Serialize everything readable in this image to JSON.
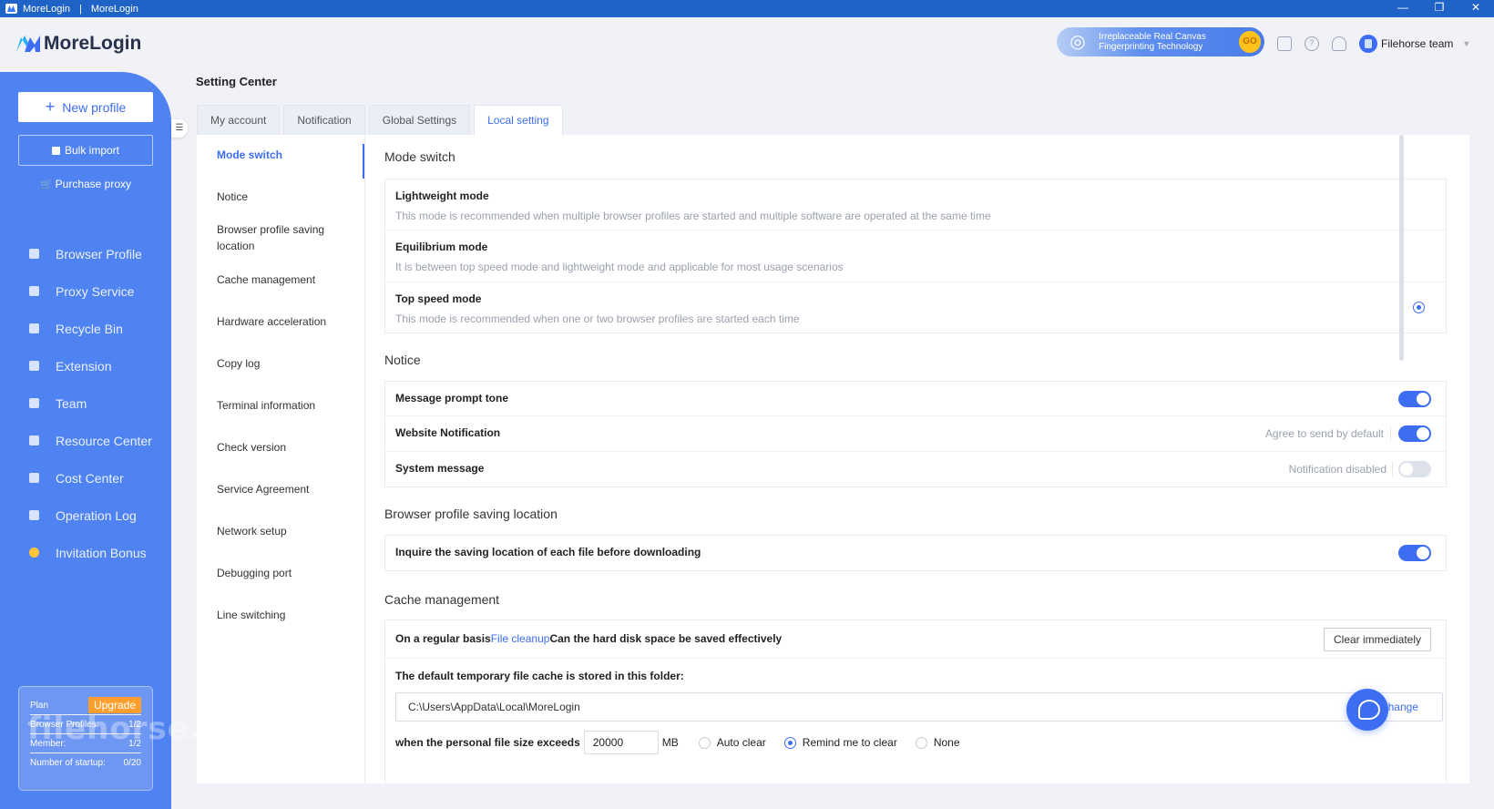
{
  "titlebar": {
    "app": "MoreLogin",
    "separator": "|",
    "window_title": "MoreLogin",
    "minimize": "—",
    "restore": "❐",
    "close": "✕"
  },
  "header": {
    "logo": "MoreLogin",
    "promo": {
      "line1": "Irreplaceable Real Canvas",
      "line2": "Fingerprinting Technology",
      "go": "GO"
    },
    "team": "Filehorse team"
  },
  "sidebar": {
    "new_profile": "New profile",
    "bulk_import": "Bulk import",
    "purchase_proxy": "Purchase proxy",
    "nav": [
      {
        "label": "Browser Profile",
        "icon": "browser-icon"
      },
      {
        "label": "Proxy Service",
        "icon": "proxy-icon"
      },
      {
        "label": "Recycle Bin",
        "icon": "trash-icon"
      },
      {
        "label": "Extension",
        "icon": "puzzle-icon"
      },
      {
        "label": "Team",
        "icon": "user-icon"
      },
      {
        "label": "Resource Center",
        "icon": "cube-icon"
      },
      {
        "label": "Cost Center",
        "icon": "wallet-icon"
      },
      {
        "label": "Operation Log",
        "icon": "log-icon"
      },
      {
        "label": "Invitation Bonus",
        "icon": "coin-icon"
      }
    ],
    "plan": {
      "plan_label": "Plan",
      "upgrade": "Upgrade",
      "profiles_label": "Browser Profiles:",
      "profiles_value": "1/2",
      "member_label": "Member:",
      "member_value": "1/2",
      "startup_label": "Number of startup:",
      "startup_value": "0/20"
    },
    "watermark": "filehorse.com"
  },
  "main": {
    "title": "Setting Center",
    "tabs": [
      "My account",
      "Notification",
      "Global Settings",
      "Local setting"
    ],
    "active_tab": "Local setting",
    "subnav": [
      "Mode switch",
      "Notice",
      "Browser profile saving location",
      "Cache management",
      "Hardware acceleration",
      "Copy log",
      "Terminal information",
      "Check version",
      "Service Agreement",
      "Network setup",
      "Debugging port",
      "Line switching"
    ],
    "mode_switch": {
      "title": "Mode switch",
      "modes": [
        {
          "label": "Lightweight mode",
          "desc": "This mode is recommended when multiple browser profiles are started and multiple software are operated at the same time"
        },
        {
          "label": "Equilibrium mode",
          "desc": "It is between top speed mode and lightweight mode and applicable for most usage scenarios"
        },
        {
          "label": "Top speed mode",
          "desc": "This mode is recommended when one or two browser profiles are started each time"
        }
      ],
      "selected": "Top speed mode"
    },
    "notice": {
      "title": "Notice",
      "message_tone": "Message prompt tone",
      "website_notification": "Website Notification",
      "website_hint": "Agree to send by default",
      "system_message": "System message",
      "system_hint": "Notification disabled"
    },
    "saving_location": {
      "title": "Browser profile saving location",
      "inquire": "Inquire the saving location of each file before downloading"
    },
    "cache": {
      "title": "Cache management",
      "regular_prefix": "On a regular basis",
      "regular_link": "File cleanup",
      "regular_suffix": "Can the hard disk space be saved effectively",
      "clear_button": "Clear immediately",
      "folder_label": "The default temporary file cache is stored in this folder:",
      "folder_path": "C:\\Users\\AppData\\Local\\MoreLogin",
      "change": "Change",
      "size_label": "when the personal file size exceeds",
      "size_value": "20000",
      "size_unit": "MB",
      "options": [
        "Auto clear",
        "Remind me to clear",
        "None"
      ],
      "selected_option": "Remind me to clear"
    }
  }
}
